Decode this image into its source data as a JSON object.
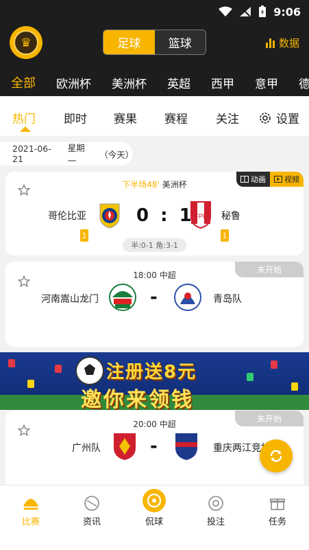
{
  "status_bar": {
    "time": "9:06"
  },
  "header": {
    "sport_tabs": [
      {
        "label": "足球",
        "active": true
      },
      {
        "label": "篮球",
        "active": false
      }
    ],
    "data_link": "数据",
    "accent_color": "#f7b500"
  },
  "league_tabs": [
    "全部",
    "欧洲杯",
    "美洲杯",
    "英超",
    "西甲",
    "意甲",
    "德"
  ],
  "sub_tabs": [
    "热门",
    "即时",
    "赛果",
    "赛程",
    "关注"
  ],
  "settings_label": "设置",
  "date_bar": {
    "date": "2021-06-21",
    "weekday": "星期一",
    "note": "（今天）"
  },
  "matches": [
    {
      "status_text": "下半场48'",
      "league": "美洲杯",
      "home": "哥伦比亚",
      "away": "秘鲁",
      "score": "0 : 1",
      "home_badge": "1",
      "away_badge": "1",
      "half_info": "半:0-1 角:3-1",
      "media": [
        "动画",
        "视频"
      ]
    },
    {
      "time": "18:00",
      "league": "中超",
      "home": "河南嵩山龙门",
      "away": "青岛队",
      "vs": "-",
      "status_tag": "未开始"
    },
    {
      "time": "20:00",
      "league": "中超",
      "home": "广州队",
      "away": "重庆两江竞技",
      "vs": "-",
      "status_tag": "未开始"
    }
  ],
  "banner": {
    "line1": "注册送8元",
    "line2": "邀你来领钱"
  },
  "bottom_nav": [
    {
      "label": "比赛",
      "icon": "trophy-icon",
      "active": true
    },
    {
      "label": "资讯",
      "icon": "ball-icon",
      "active": false
    },
    {
      "label": "侃球",
      "icon": "chat-icon",
      "active": false
    },
    {
      "label": "投注",
      "icon": "bet-icon",
      "active": false
    },
    {
      "label": "任务",
      "icon": "gift-icon",
      "active": false
    }
  ]
}
